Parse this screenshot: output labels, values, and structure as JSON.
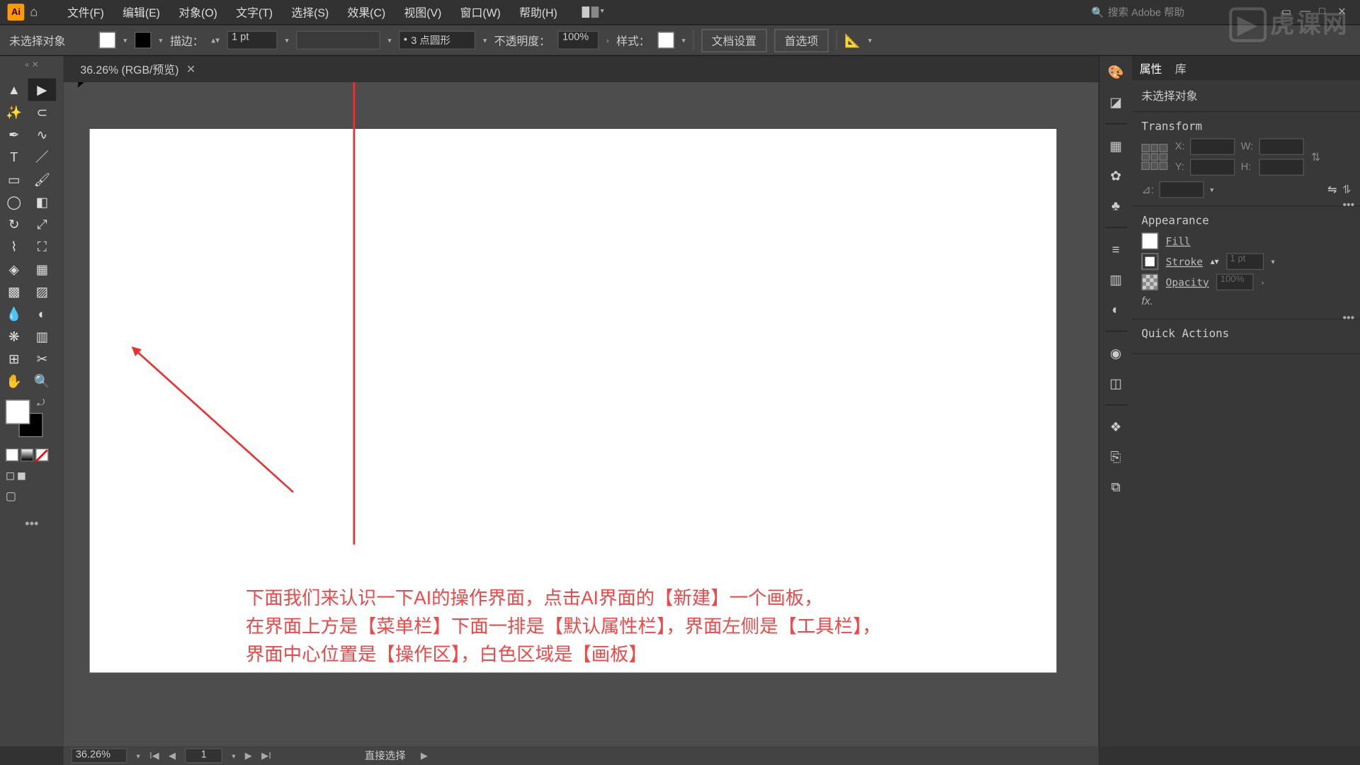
{
  "menu": {
    "items": [
      "文件(F)",
      "编辑(E)",
      "对象(O)",
      "文字(T)",
      "选择(S)",
      "效果(C)",
      "视图(V)",
      "窗口(W)",
      "帮助(H)"
    ]
  },
  "search_placeholder": "搜索 Adobe 帮助",
  "optbar": {
    "no_sel": "未选择对象",
    "stroke_label": "描边：",
    "stroke_val": "1 pt",
    "brush_val": "3 点圆形",
    "opacity_label": "不透明度：",
    "opacity_val": "100%",
    "style_label": "样式：",
    "doc_setup": "文档设置",
    "prefs": "首选项"
  },
  "doc": {
    "tab": "36.26% (RGB/预览)"
  },
  "caption": {
    "l1": "下面我们来认识一下AI的操作界面，点击AI界面的【新建】一个画板，",
    "l2": "在界面上方是【菜单栏】下面一排是【默认属性栏】，界面左侧是【工具栏】，",
    "l3": "界面中心位置是【操作区】，白色区域是【画板】"
  },
  "status": {
    "zoom": "36.26%",
    "artboard": "1",
    "tool": "直接选择"
  },
  "panels": {
    "tab_props": "属性",
    "tab_lib": "库",
    "no_sel": "未选择对象",
    "transform": "Transform",
    "x": "X:",
    "y": "Y:",
    "w": "W:",
    "h": "H:",
    "angle": "⊿:",
    "appearance": "Appearance",
    "fill": "Fill",
    "stroke": "Stroke",
    "stroke_val": "1 pt",
    "opacity": "Opacity",
    "opacity_val": "100%",
    "fx": "fx.",
    "quick": "Quick Actions"
  },
  "watermark": "虎课网"
}
